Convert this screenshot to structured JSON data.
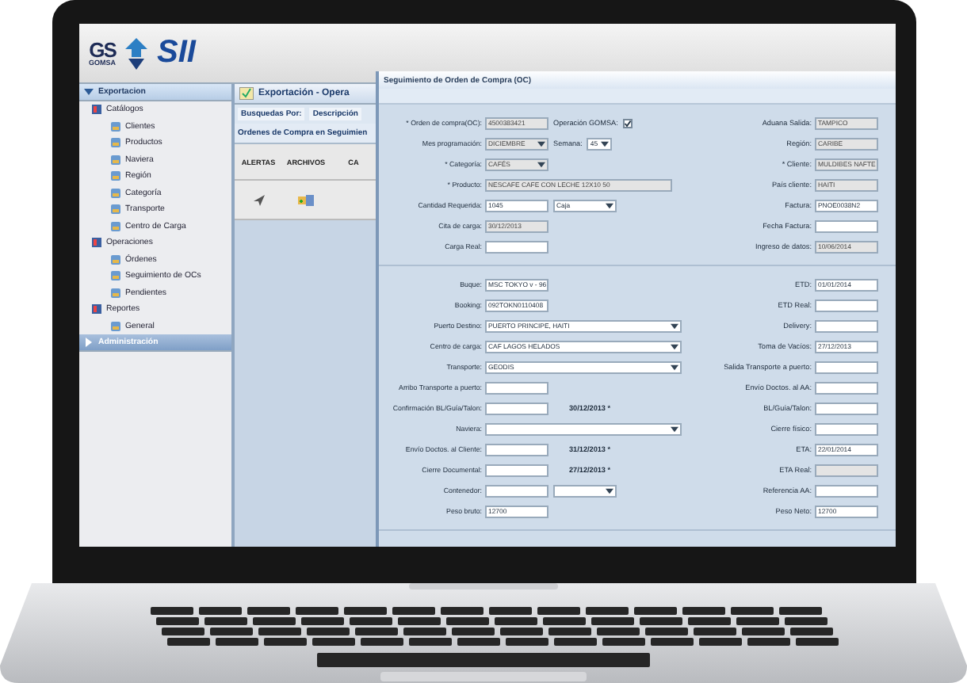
{
  "header": {
    "logo_text": "GS",
    "logo_subtext": "GOMSA",
    "brand": "SII"
  },
  "sidebar": {
    "sections": [
      {
        "label": "Exportacion",
        "expanded": true,
        "children": [
          {
            "label": "Catálogos",
            "children": [
              {
                "label": "Clientes"
              },
              {
                "label": "Productos"
              },
              {
                "label": "Naviera"
              },
              {
                "label": "Región"
              },
              {
                "label": "Categoría"
              },
              {
                "label": "Transporte"
              },
              {
                "label": "Centro de Carga"
              }
            ]
          },
          {
            "label": "Operaciones",
            "children": [
              {
                "label": "Órdenes"
              },
              {
                "label": "Seguimiento de OCs"
              },
              {
                "label": "Pendientes"
              }
            ]
          },
          {
            "label": "Reportes",
            "children": [
              {
                "label": "General"
              }
            ]
          }
        ]
      },
      {
        "label": "Administración",
        "expanded": false
      }
    ]
  },
  "panel": {
    "title": "Exportación - Opera",
    "search_label": "Busquedas Por:",
    "search_option": "Descripción",
    "grid_title": "Ordenes de Compra en Seguimien",
    "columns": [
      "ALERTAS",
      "ARCHIVOS",
      "CA"
    ]
  },
  "dialog": {
    "title": "Seguimiento de Orden de Compra (OC)",
    "sections": [
      {
        "rows": [
          {
            "left": [
              {
                "kind": "label",
                "text": "* Orden de compra(OC):"
              },
              {
                "kind": "field",
                "value": "4500383421",
                "disabled": true
              },
              {
                "kind": "label",
                "text": "Operación GOMSA:"
              },
              {
                "kind": "check",
                "checked": true
              }
            ],
            "right": [
              {
                "kind": "label",
                "text": "Aduana Salida:"
              },
              {
                "kind": "field",
                "value": "TAMPICO",
                "disabled": true
              }
            ]
          },
          {
            "left": [
              {
                "kind": "label",
                "text": "Mes programación:"
              },
              {
                "kind": "select",
                "value": "DICIEMBRE",
                "disabled": true
              },
              {
                "kind": "label",
                "text": "Semana:"
              },
              {
                "kind": "short-select",
                "value": "45",
                "disabled": false
              }
            ],
            "right": [
              {
                "kind": "label",
                "text": "Región:"
              },
              {
                "kind": "field",
                "value": "CARIBE",
                "disabled": true
              }
            ]
          },
          {
            "left": [
              {
                "kind": "label",
                "text": "* Categoría:"
              },
              {
                "kind": "select",
                "value": "CAFÉS",
                "disabled": true
              }
            ],
            "right": [
              {
                "kind": "label",
                "text": "* Cliente:"
              },
              {
                "kind": "field",
                "value": "MULDIBES NAFTE",
                "disabled": true
              }
            ]
          },
          {
            "left": [
              {
                "kind": "label",
                "text": "* Producto:"
              },
              {
                "kind": "wide-field",
                "value": "NESCAFE CAFE CON LECHE 12X10 50",
                "disabled": true
              }
            ],
            "right": [
              {
                "kind": "label",
                "text": "País cliente:"
              },
              {
                "kind": "field",
                "value": "HAITI",
                "disabled": true
              }
            ]
          },
          {
            "left": [
              {
                "kind": "label",
                "text": "Cantidad Requerida:"
              },
              {
                "kind": "field",
                "value": "1045",
                "disabled": false
              },
              {
                "kind": "select",
                "value": "Caja",
                "disabled": false
              }
            ],
            "right": [
              {
                "kind": "label",
                "text": "Factura:"
              },
              {
                "kind": "field",
                "value": "PNOE0038N2",
                "disabled": false
              }
            ]
          },
          {
            "left": [
              {
                "kind": "label",
                "text": "Cita de carga:"
              },
              {
                "kind": "field",
                "value": "30/12/2013",
                "disabled": true
              }
            ],
            "right": [
              {
                "kind": "label",
                "text": "Fecha Factura:"
              },
              {
                "kind": "field",
                "disabled": false
              }
            ]
          },
          {
            "left": [
              {
                "kind": "label",
                "text": "Carga Real:"
              },
              {
                "kind": "field",
                "disabled": false
              }
            ],
            "right": [
              {
                "kind": "label",
                "text": "Ingreso de datos:"
              },
              {
                "kind": "field",
                "value": "10/06/2014",
                "disabled": true
              }
            ]
          }
        ]
      },
      {
        "rows": [
          {
            "left": [
              {
                "kind": "label",
                "text": "Buque:"
              },
              {
                "kind": "field",
                "value": "MSC TOKYO v - 96",
                "disabled": false
              }
            ],
            "right": [
              {
                "kind": "label",
                "text": "ETD:"
              },
              {
                "kind": "field",
                "value": "01/01/2014",
                "disabled": false
              }
            ]
          },
          {
            "left": [
              {
                "kind": "label",
                "text": "Booking:"
              },
              {
                "kind": "field",
                "value": "092TOKN0110408",
                "disabled": false
              }
            ],
            "right": [
              {
                "kind": "label",
                "text": "ETD Real:"
              },
              {
                "kind": "field",
                "disabled": false
              }
            ]
          },
          {
            "left": [
              {
                "kind": "label",
                "text": "Puerto Destino:"
              },
              {
                "kind": "wide-select",
                "value": "PUERTO PRINCIPE, HAITI",
                "disabled": false
              }
            ],
            "right": [
              {
                "kind": "label",
                "text": "Delivery:"
              },
              {
                "kind": "field",
                "disabled": false
              }
            ]
          },
          {
            "left": [
              {
                "kind": "label",
                "text": "Centro de carga:"
              },
              {
                "kind": "wide-select",
                "value": "CAF LAGOS HELADOS",
                "disabled": false
              }
            ],
            "right": [
              {
                "kind": "label",
                "text": "Toma de Vacíos:"
              },
              {
                "kind": "field",
                "value": "27/12/2013",
                "disabled": false
              }
            ]
          },
          {
            "left": [
              {
                "kind": "label",
                "text": "Transporte:"
              },
              {
                "kind": "wide-select",
                "value": "GEODIS",
                "disabled": false
              }
            ],
            "right": [
              {
                "kind": "label",
                "text": "Salida Transporte a puerto:"
              },
              {
                "kind": "field",
                "disabled": false
              }
            ]
          },
          {
            "left": [
              {
                "kind": "label",
                "text": "Arribo Transporte a puerto:"
              },
              {
                "kind": "field",
                "disabled": false
              }
            ],
            "right": [
              {
                "kind": "label",
                "text": "Envío Doctos. al AA:"
              },
              {
                "kind": "field",
                "disabled": false
              }
            ]
          },
          {
            "left": [
              {
                "kind": "label",
                "text": "Confirmación BL/Guía/Talon:"
              },
              {
                "kind": "field",
                "disabled": false
              },
              {
                "kind": "note",
                "text": "30/12/2013 *"
              }
            ],
            "right": [
              {
                "kind": "label",
                "text": "BL/Guía/Talon:"
              },
              {
                "kind": "field",
                "disabled": false
              }
            ]
          },
          {
            "left": [
              {
                "kind": "label",
                "text": "Naviera:"
              },
              {
                "kind": "wide-select",
                "disabled": false
              }
            ],
            "right": [
              {
                "kind": "label",
                "text": "Cierre físico:"
              },
              {
                "kind": "field",
                "disabled": false
              }
            ]
          },
          {
            "left": [
              {
                "kind": "label",
                "text": "Envío Doctos. al Cliente:"
              },
              {
                "kind": "field",
                "disabled": false
              },
              {
                "kind": "note",
                "text": "31/12/2013 *"
              }
            ],
            "right": [
              {
                "kind": "label",
                "text": "ETA:"
              },
              {
                "kind": "field",
                "value": "22/01/2014",
                "disabled": false
              }
            ]
          },
          {
            "left": [
              {
                "kind": "label",
                "text": "Cierre Documental:"
              },
              {
                "kind": "field",
                "disabled": false
              },
              {
                "kind": "note",
                "text": "27/12/2013 *"
              }
            ],
            "right": [
              {
                "kind": "label",
                "text": "ETA Real:"
              },
              {
                "kind": "field",
                "disabled": true
              }
            ]
          },
          {
            "left": [
              {
                "kind": "label",
                "text": "Contenedor:"
              },
              {
                "kind": "field",
                "disabled": false
              },
              {
                "kind": "select",
                "disabled": false
              }
            ],
            "right": [
              {
                "kind": "label",
                "text": "Referencia AA:"
              },
              {
                "kind": "field",
                "disabled": false
              }
            ]
          },
          {
            "left": [
              {
                "kind": "label",
                "text": "Peso bruto:"
              },
              {
                "kind": "field",
                "value": "12700",
                "disabled": false
              }
            ],
            "right": [
              {
                "kind": "label",
                "text": "Peso Neto:"
              },
              {
                "kind": "field",
                "value": "12700",
                "disabled": false
              }
            ]
          }
        ]
      }
    ]
  }
}
